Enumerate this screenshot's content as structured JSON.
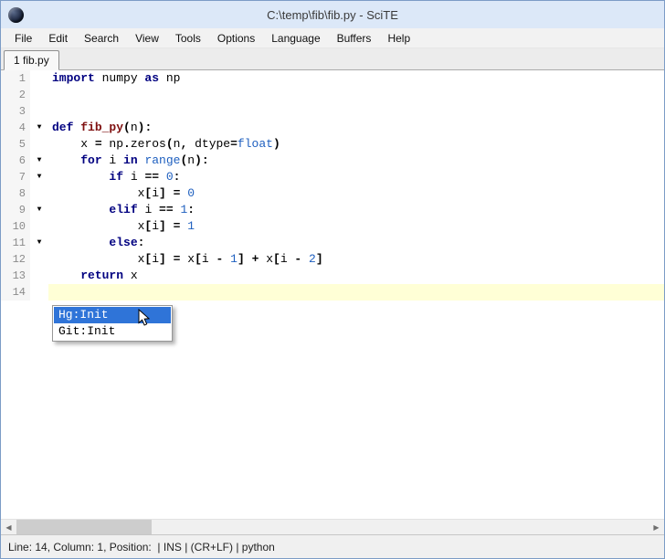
{
  "window": {
    "title": "C:\\temp\\fib\\fib.py - SciTE"
  },
  "menu": {
    "items": [
      "File",
      "Edit",
      "Search",
      "View",
      "Tools",
      "Options",
      "Language",
      "Buffers",
      "Help"
    ]
  },
  "tabs": [
    {
      "label": "1 fib.py",
      "active": true
    }
  ],
  "editor": {
    "current_line": 14,
    "lines": [
      {
        "n": 1,
        "fold": false,
        "tokens": [
          {
            "t": "import",
            "c": "k"
          },
          {
            "t": " numpy ",
            "c": "p"
          },
          {
            "t": "as",
            "c": "k"
          },
          {
            "t": " np",
            "c": "p"
          }
        ]
      },
      {
        "n": 2,
        "fold": false,
        "tokens": []
      },
      {
        "n": 3,
        "fold": false,
        "tokens": []
      },
      {
        "n": 4,
        "fold": true,
        "tokens": [
          {
            "t": "def",
            "c": "k"
          },
          {
            "t": " ",
            "c": "p"
          },
          {
            "t": "fib_py",
            "c": "d"
          },
          {
            "t": "(",
            "c": "o"
          },
          {
            "t": "n",
            "c": "p"
          },
          {
            "t": "):",
            "c": "o"
          }
        ]
      },
      {
        "n": 5,
        "fold": false,
        "tokens": [
          {
            "t": "    x ",
            "c": "p"
          },
          {
            "t": "=",
            "c": "o"
          },
          {
            "t": " np",
            "c": "p"
          },
          {
            "t": ".",
            "c": "o"
          },
          {
            "t": "zeros",
            "c": "p"
          },
          {
            "t": "(",
            "c": "o"
          },
          {
            "t": "n",
            "c": "p"
          },
          {
            "t": ",",
            "c": "o"
          },
          {
            "t": " dtype",
            "c": "p"
          },
          {
            "t": "=",
            "c": "o"
          },
          {
            "t": "float",
            "c": "b"
          },
          {
            "t": ")",
            "c": "o"
          }
        ]
      },
      {
        "n": 6,
        "fold": true,
        "tokens": [
          {
            "t": "    ",
            "c": "p"
          },
          {
            "t": "for",
            "c": "k"
          },
          {
            "t": " i ",
            "c": "p"
          },
          {
            "t": "in",
            "c": "k"
          },
          {
            "t": " ",
            "c": "p"
          },
          {
            "t": "range",
            "c": "b"
          },
          {
            "t": "(",
            "c": "o"
          },
          {
            "t": "n",
            "c": "p"
          },
          {
            "t": "):",
            "c": "o"
          }
        ]
      },
      {
        "n": 7,
        "fold": true,
        "tokens": [
          {
            "t": "        ",
            "c": "p"
          },
          {
            "t": "if",
            "c": "k"
          },
          {
            "t": " i ",
            "c": "p"
          },
          {
            "t": "==",
            "c": "o"
          },
          {
            "t": " ",
            "c": "p"
          },
          {
            "t": "0",
            "c": "n"
          },
          {
            "t": ":",
            "c": "o"
          }
        ]
      },
      {
        "n": 8,
        "fold": false,
        "tokens": [
          {
            "t": "            x",
            "c": "p"
          },
          {
            "t": "[",
            "c": "o"
          },
          {
            "t": "i",
            "c": "p"
          },
          {
            "t": "]",
            "c": "o"
          },
          {
            "t": " ",
            "c": "p"
          },
          {
            "t": "=",
            "c": "o"
          },
          {
            "t": " ",
            "c": "p"
          },
          {
            "t": "0",
            "c": "n"
          }
        ]
      },
      {
        "n": 9,
        "fold": true,
        "tokens": [
          {
            "t": "        ",
            "c": "p"
          },
          {
            "t": "elif",
            "c": "k"
          },
          {
            "t": " i ",
            "c": "p"
          },
          {
            "t": "==",
            "c": "o"
          },
          {
            "t": " ",
            "c": "p"
          },
          {
            "t": "1",
            "c": "n"
          },
          {
            "t": ":",
            "c": "o"
          }
        ]
      },
      {
        "n": 10,
        "fold": false,
        "tokens": [
          {
            "t": "            x",
            "c": "p"
          },
          {
            "t": "[",
            "c": "o"
          },
          {
            "t": "i",
            "c": "p"
          },
          {
            "t": "]",
            "c": "o"
          },
          {
            "t": " ",
            "c": "p"
          },
          {
            "t": "=",
            "c": "o"
          },
          {
            "t": " ",
            "c": "p"
          },
          {
            "t": "1",
            "c": "n"
          }
        ]
      },
      {
        "n": 11,
        "fold": true,
        "tokens": [
          {
            "t": "        ",
            "c": "p"
          },
          {
            "t": "else",
            "c": "k"
          },
          {
            "t": ":",
            "c": "o"
          }
        ]
      },
      {
        "n": 12,
        "fold": false,
        "tokens": [
          {
            "t": "            x",
            "c": "p"
          },
          {
            "t": "[",
            "c": "o"
          },
          {
            "t": "i",
            "c": "p"
          },
          {
            "t": "]",
            "c": "o"
          },
          {
            "t": " ",
            "c": "p"
          },
          {
            "t": "=",
            "c": "o"
          },
          {
            "t": " x",
            "c": "p"
          },
          {
            "t": "[",
            "c": "o"
          },
          {
            "t": "i ",
            "c": "p"
          },
          {
            "t": "-",
            "c": "o"
          },
          {
            "t": " ",
            "c": "p"
          },
          {
            "t": "1",
            "c": "n"
          },
          {
            "t": "]",
            "c": "o"
          },
          {
            "t": " ",
            "c": "p"
          },
          {
            "t": "+",
            "c": "o"
          },
          {
            "t": " x",
            "c": "p"
          },
          {
            "t": "[",
            "c": "o"
          },
          {
            "t": "i ",
            "c": "p"
          },
          {
            "t": "-",
            "c": "o"
          },
          {
            "t": " ",
            "c": "p"
          },
          {
            "t": "2",
            "c": "n"
          },
          {
            "t": "]",
            "c": "o"
          }
        ]
      },
      {
        "n": 13,
        "fold": false,
        "tokens": [
          {
            "t": "    ",
            "c": "p"
          },
          {
            "t": "return",
            "c": "k"
          },
          {
            "t": " x",
            "c": "p"
          }
        ]
      },
      {
        "n": 14,
        "fold": false,
        "tokens": []
      }
    ]
  },
  "popup": {
    "items": [
      {
        "label": "Hg:Init",
        "selected": true
      },
      {
        "label": "Git:Init",
        "selected": false
      }
    ]
  },
  "statusbar": {
    "text": "Line: 14, Column: 1, Position:  | INS | (CR+LF) | python"
  },
  "colors": {
    "titlebar_bg": "#dce8f8",
    "keyword": "#000080",
    "defname": "#7f1010",
    "number": "#1e5fbf",
    "builtin": "#1e5fbf",
    "selection": "#2f74d8",
    "caret_line": "#ffffd6"
  }
}
